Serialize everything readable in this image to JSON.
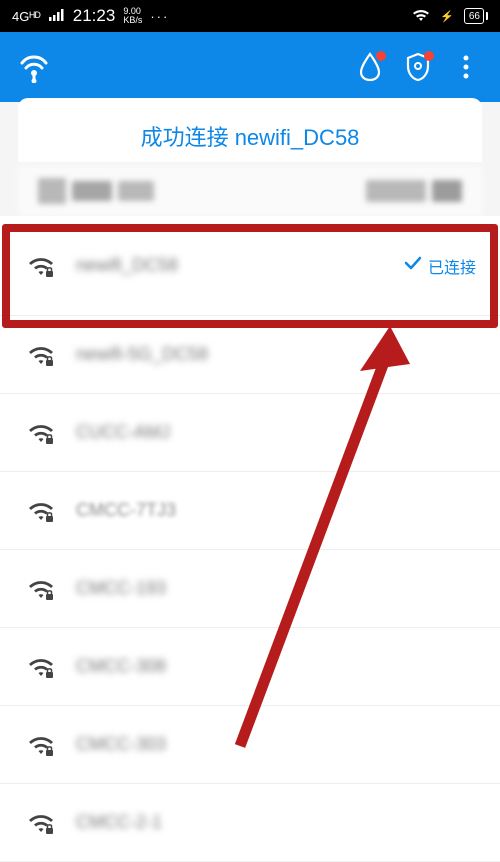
{
  "status": {
    "net": "4Gᴴᴰ",
    "time": "21:23",
    "kbs_top": "9.00",
    "kbs_bot": "KB/s",
    "dots": "···",
    "battery": "66"
  },
  "header": {
    "raindrop": "raindrop",
    "shield": "shield",
    "menu": "menu"
  },
  "banner": {
    "text": "成功连接 newifi_DC58"
  },
  "wifi": {
    "connected_label": "已连接",
    "items": [
      {
        "name": "newifi_DC58",
        "connected": true
      },
      {
        "name": "newifi-5G_DC58",
        "connected": false
      },
      {
        "name": "CUCC-AMJ",
        "connected": false
      },
      {
        "name": "CMCC-7TJ3",
        "connected": false
      },
      {
        "name": "CMCC-193",
        "connected": false
      },
      {
        "name": "CMCC-308",
        "connected": false
      },
      {
        "name": "CMCC-303",
        "connected": false
      },
      {
        "name": "CMCC-2-1",
        "connected": false
      }
    ]
  }
}
